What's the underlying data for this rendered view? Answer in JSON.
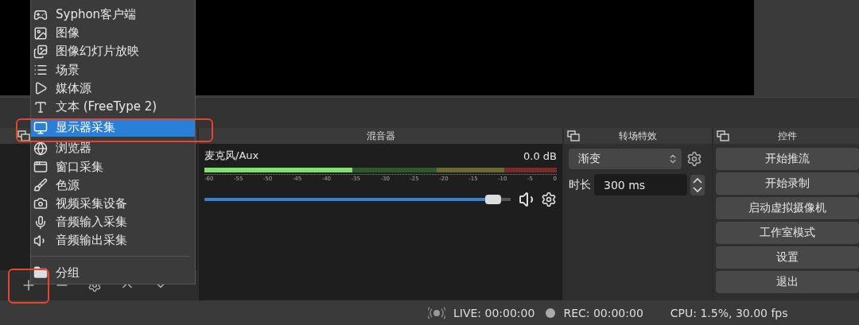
{
  "source_menu": {
    "items": [
      {
        "label": "Syphon客户端",
        "selected": false
      },
      {
        "label": "图像",
        "selected": false
      },
      {
        "label": "图像幻灯片放映",
        "selected": false
      },
      {
        "label": "场景",
        "selected": false
      },
      {
        "label": "媒体源",
        "selected": false
      },
      {
        "label": "文本 (FreeType 2)",
        "selected": false
      },
      {
        "label": "显示器采集",
        "selected": true
      },
      {
        "label": "浏览器",
        "selected": false
      },
      {
        "label": "窗口采集",
        "selected": false
      },
      {
        "label": "色源",
        "selected": false
      },
      {
        "label": "视频采集设备",
        "selected": false
      },
      {
        "label": "音频输入采集",
        "selected": false
      },
      {
        "label": "音频输出采集",
        "selected": false
      }
    ],
    "footer_items": [
      {
        "label": "分组",
        "selected": false
      }
    ]
  },
  "mixer": {
    "title": "混音器",
    "channels": [
      {
        "name": "麦克风/Aux",
        "reading": "0.0 dB",
        "meter": {
          "level": 0.42
        },
        "volume": {
          "level": 0.97
        },
        "scale": [
          "-60",
          "-55",
          "-50",
          "-45",
          "-40",
          "-35",
          "-30",
          "-25",
          "-20",
          "-15",
          "-10",
          "-5",
          "0"
        ]
      }
    ]
  },
  "transitions": {
    "title": "转场特效",
    "transition": "渐变",
    "duration_label": "时长",
    "duration": "300 ms"
  },
  "controls": {
    "title": "控件",
    "buttons": [
      "开始推流",
      "开始录制",
      "启动虚拟摄像机",
      "工作室模式",
      "设置",
      "退出"
    ]
  },
  "status_bar": {
    "live": "LIVE: 00:00:00",
    "rec": "REC: 00:00:00",
    "cpu": "CPU: 1.5%, 30.00 fps"
  }
}
